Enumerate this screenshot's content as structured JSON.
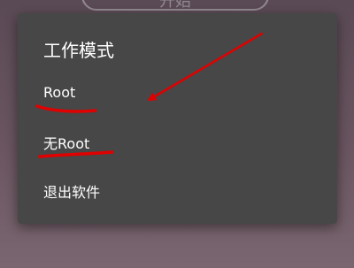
{
  "background": {
    "start_button_label": "开始"
  },
  "dialog": {
    "title": "工作模式",
    "options": [
      {
        "label": "Root"
      },
      {
        "label": "无Root"
      },
      {
        "label": "退出软件"
      }
    ]
  },
  "colors": {
    "dialog_bg": "#474747",
    "annotation": "#e00000"
  }
}
